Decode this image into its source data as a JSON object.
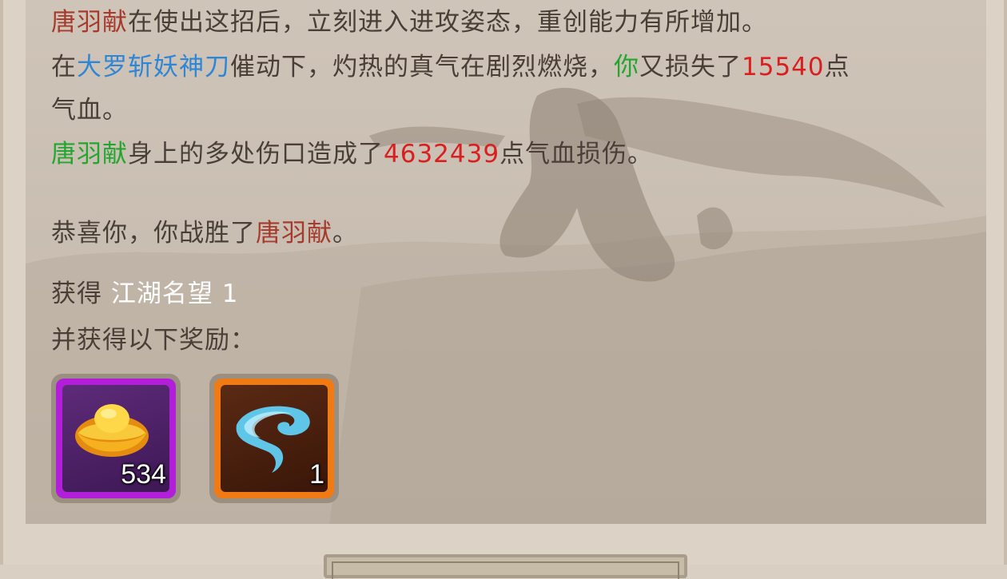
{
  "colors": {
    "npc": "#a63a2c",
    "skill": "#2e86d6",
    "you": "#23a62f",
    "damage": "#d91f1f",
    "body_text": "#4a3f36",
    "reward_rare": "#b11fd8",
    "reward_epic": "#f07a14"
  },
  "log": {
    "line1": {
      "npc": "唐羽献",
      "text": "在使出这招后，立刻进入进攻姿态，重创能力有所增加。"
    },
    "line2": {
      "prefix": "在",
      "skill": "大罗斩妖神刀",
      "mid": "催动下，灼热的真气在剧烈燃烧，",
      "you": "你",
      "mid2": "又损失了",
      "damage": "15540",
      "suffix": "点",
      "cont": "气血。"
    },
    "line3": {
      "npc": "唐羽献",
      "mid": "身上的多处伤口造成了",
      "damage": "4632439",
      "suffix": "点气血损伤。"
    },
    "victory": {
      "prefix": "恭喜你，你战胜了",
      "npc": "唐羽献",
      "suffix": "。"
    },
    "gain": {
      "label": "获得",
      "value": "江湖名望 1"
    },
    "rewards_label": "并获得以下奖励："
  },
  "rewards": [
    {
      "icon": "gold-ingot-icon",
      "count": "534",
      "rarity": "purple"
    },
    {
      "icon": "blue-vortex-icon",
      "count": "1",
      "rarity": "orange"
    }
  ]
}
